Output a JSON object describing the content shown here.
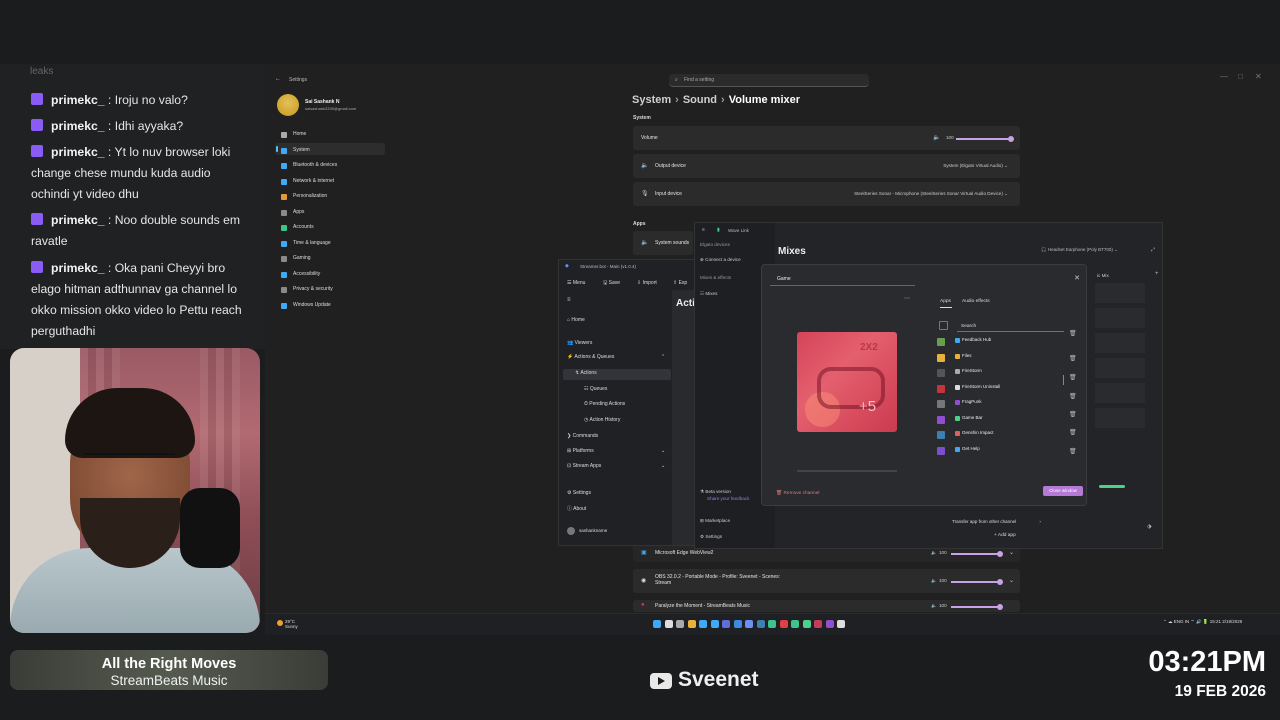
{
  "chat": {
    "top_text": "leaks",
    "messages": [
      {
        "user": "primekc_",
        "text": ": Iroju no valo?"
      },
      {
        "user": "primekc_",
        "text": ": Idhi ayyaka?"
      },
      {
        "user": "primekc_",
        "text": ": Yt lo nuv browser loki change chese mundu kuda audio ochindi yt video dhu"
      },
      {
        "user": "primekc_",
        "text": ": Noo double sounds em ravatle"
      },
      {
        "user": "primekc_",
        "text": ": Oka pani Cheyyi bro elago hitman adthunnav ga channel lo okko mission okko video lo Pettu reach perguthadhi"
      }
    ]
  },
  "now_playing": {
    "title": "All the Right Moves",
    "artist": "StreamBeats Music"
  },
  "handle": "Sveenet",
  "clock": {
    "time": "03:21PM",
    "date": "19 FEB 2026"
  },
  "settings": {
    "window_title": "Settings",
    "search_placeholder": "Find a setting",
    "user_name": "Sai Sashank N",
    "user_email": "saisashank3339@gmail.com",
    "nav": [
      "Home",
      "System",
      "Bluetooth & devices",
      "Network & internet",
      "Personalization",
      "Apps",
      "Accounts",
      "Time & language",
      "Gaming",
      "Accessibility",
      "Privacy & security",
      "Windows Update"
    ],
    "breadcrumb": {
      "a": "System",
      "b": "Sound",
      "c": "Volume mixer"
    },
    "system_label": "System",
    "volume_label": "Volume",
    "volume_value": "100",
    "output_label": "Output device",
    "output_value": "System (Elgato Virtual Audio)",
    "input_label": "Input device",
    "input_value": "SteelSeries Sonar - Microphone (SteelSeries Sonar Virtual Audio Device)",
    "apps_label": "Apps",
    "system_sounds": "System sounds",
    "apps": [
      {
        "name": "Microsoft Edge WebView2",
        "volume": "100"
      },
      {
        "name": "OBS 32.0.2 - Portable Mode - Profile: Sveenet - Scenes: Stream",
        "volume": "100"
      },
      {
        "name": "Paralyze the Moment - StreamBeats Music",
        "volume": "100"
      }
    ]
  },
  "streamerbot": {
    "title": "Streamer.bot - Main (v1.0.4)",
    "toolbar": [
      "Menu",
      "Save",
      "Import",
      "Exp"
    ],
    "nav": [
      "Home",
      "Viewers",
      "Actions & Queues",
      "Actions",
      "Queues",
      "Pending Actions",
      "Action History",
      "Commands",
      "Platforms",
      "Stream Apps",
      "Settings",
      "About"
    ],
    "user": "sashanknarne",
    "main_title": "Acti"
  },
  "wavelink": {
    "title": "Wave Link",
    "side": [
      "Elgato devices",
      "Connect a device",
      "Mixes & effects",
      "Mixes",
      "Beta version",
      "Share your feedback",
      "Marketplace",
      "Settings"
    ],
    "heading": "Mixes",
    "device": "Headset Earphone (Poly BT700)",
    "mix_label": "ic Mix"
  },
  "dialog": {
    "name": "Game",
    "tabs": [
      "Apps",
      "Audio effects"
    ],
    "search": "Search",
    "apps": [
      "Feedback Hub",
      "Files",
      "FireStorm",
      "FireStorm Uninstall",
      "FragPunk",
      "Game Bar",
      "Genshin Impact",
      "Get Help"
    ],
    "transfer": "Transfer app from other channel",
    "add_app": "+ Add app",
    "remove": "Remove channel",
    "close": "Close window",
    "tile_number": "+5",
    "tile_mark": "2X2"
  },
  "taskbar": {
    "temp": "29°C",
    "condition": "Sunny",
    "lang": "ENG IN",
    "time": "15:21",
    "date": "2/19/2026"
  },
  "colors": {
    "accent": "#c7a2e6",
    "twitch": "#8a5cf5",
    "close_button": "#b579d6"
  }
}
